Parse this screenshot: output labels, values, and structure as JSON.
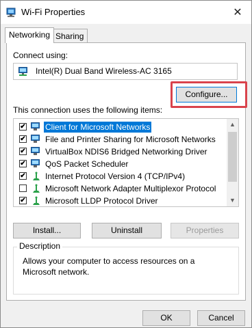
{
  "window": {
    "title": "Wi-Fi Properties",
    "close_label": "✕"
  },
  "tabs": [
    {
      "label": "Networking",
      "active": true
    },
    {
      "label": "Sharing",
      "active": false
    }
  ],
  "connect_using": {
    "label": "Connect using:",
    "adapter": "Intel(R) Dual Band Wireless-AC 3165",
    "configure_label": "Configure..."
  },
  "items_section": {
    "label": "This connection uses the following items:",
    "items": [
      {
        "label": "Client for Microsoft Networks",
        "checked": true,
        "icon": "network-client-icon",
        "selected": true
      },
      {
        "label": "File and Printer Sharing for Microsoft Networks",
        "checked": true,
        "icon": "network-service-icon",
        "selected": false
      },
      {
        "label": "VirtualBox NDIS6 Bridged Networking Driver",
        "checked": true,
        "icon": "network-service-icon",
        "selected": false
      },
      {
        "label": "QoS Packet Scheduler",
        "checked": true,
        "icon": "network-service-icon",
        "selected": false
      },
      {
        "label": "Internet Protocol Version 4 (TCP/IPv4)",
        "checked": true,
        "icon": "protocol-icon",
        "selected": false
      },
      {
        "label": "Microsoft Network Adapter Multiplexor Protocol",
        "checked": false,
        "icon": "protocol-icon",
        "selected": false
      },
      {
        "label": "Microsoft LLDP Protocol Driver",
        "checked": true,
        "icon": "protocol-icon",
        "selected": false
      }
    ]
  },
  "buttons": {
    "install": "Install...",
    "uninstall": "Uninstall",
    "properties": "Properties",
    "ok": "OK",
    "cancel": "Cancel"
  },
  "description": {
    "legend": "Description",
    "text": "Allows your computer to access resources on a Microsoft network."
  },
  "colors": {
    "highlight": "#d9434c",
    "selection": "#0078d7"
  }
}
